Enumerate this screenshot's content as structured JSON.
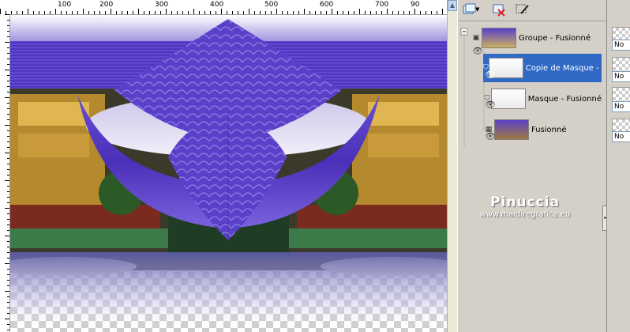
{
  "ruler": {
    "labels": [
      "100",
      "200",
      "300",
      "400",
      "500",
      "600",
      "700",
      "800",
      "90"
    ]
  },
  "layers": {
    "items": [
      {
        "name": "Groupe - Fusionné",
        "kind": "group",
        "selected": false
      },
      {
        "name": "Copie de Masque - Fus",
        "kind": "mask",
        "selected": true
      },
      {
        "name": "Masque - Fusionné",
        "kind": "mask",
        "selected": false
      },
      {
        "name": "Fusionné",
        "kind": "raster",
        "selected": false
      }
    ]
  },
  "right_panel": {
    "fields": [
      "No",
      "No",
      "No",
      "No"
    ]
  },
  "watermark": {
    "title": "Pinuccia",
    "url": "www.maidiregrafica.eu"
  },
  "colors": {
    "purple": "#5a3fc8",
    "purple_light": "#8f7ee6",
    "selection": "#316ac5",
    "panel_bg": "#d4d0c8"
  }
}
